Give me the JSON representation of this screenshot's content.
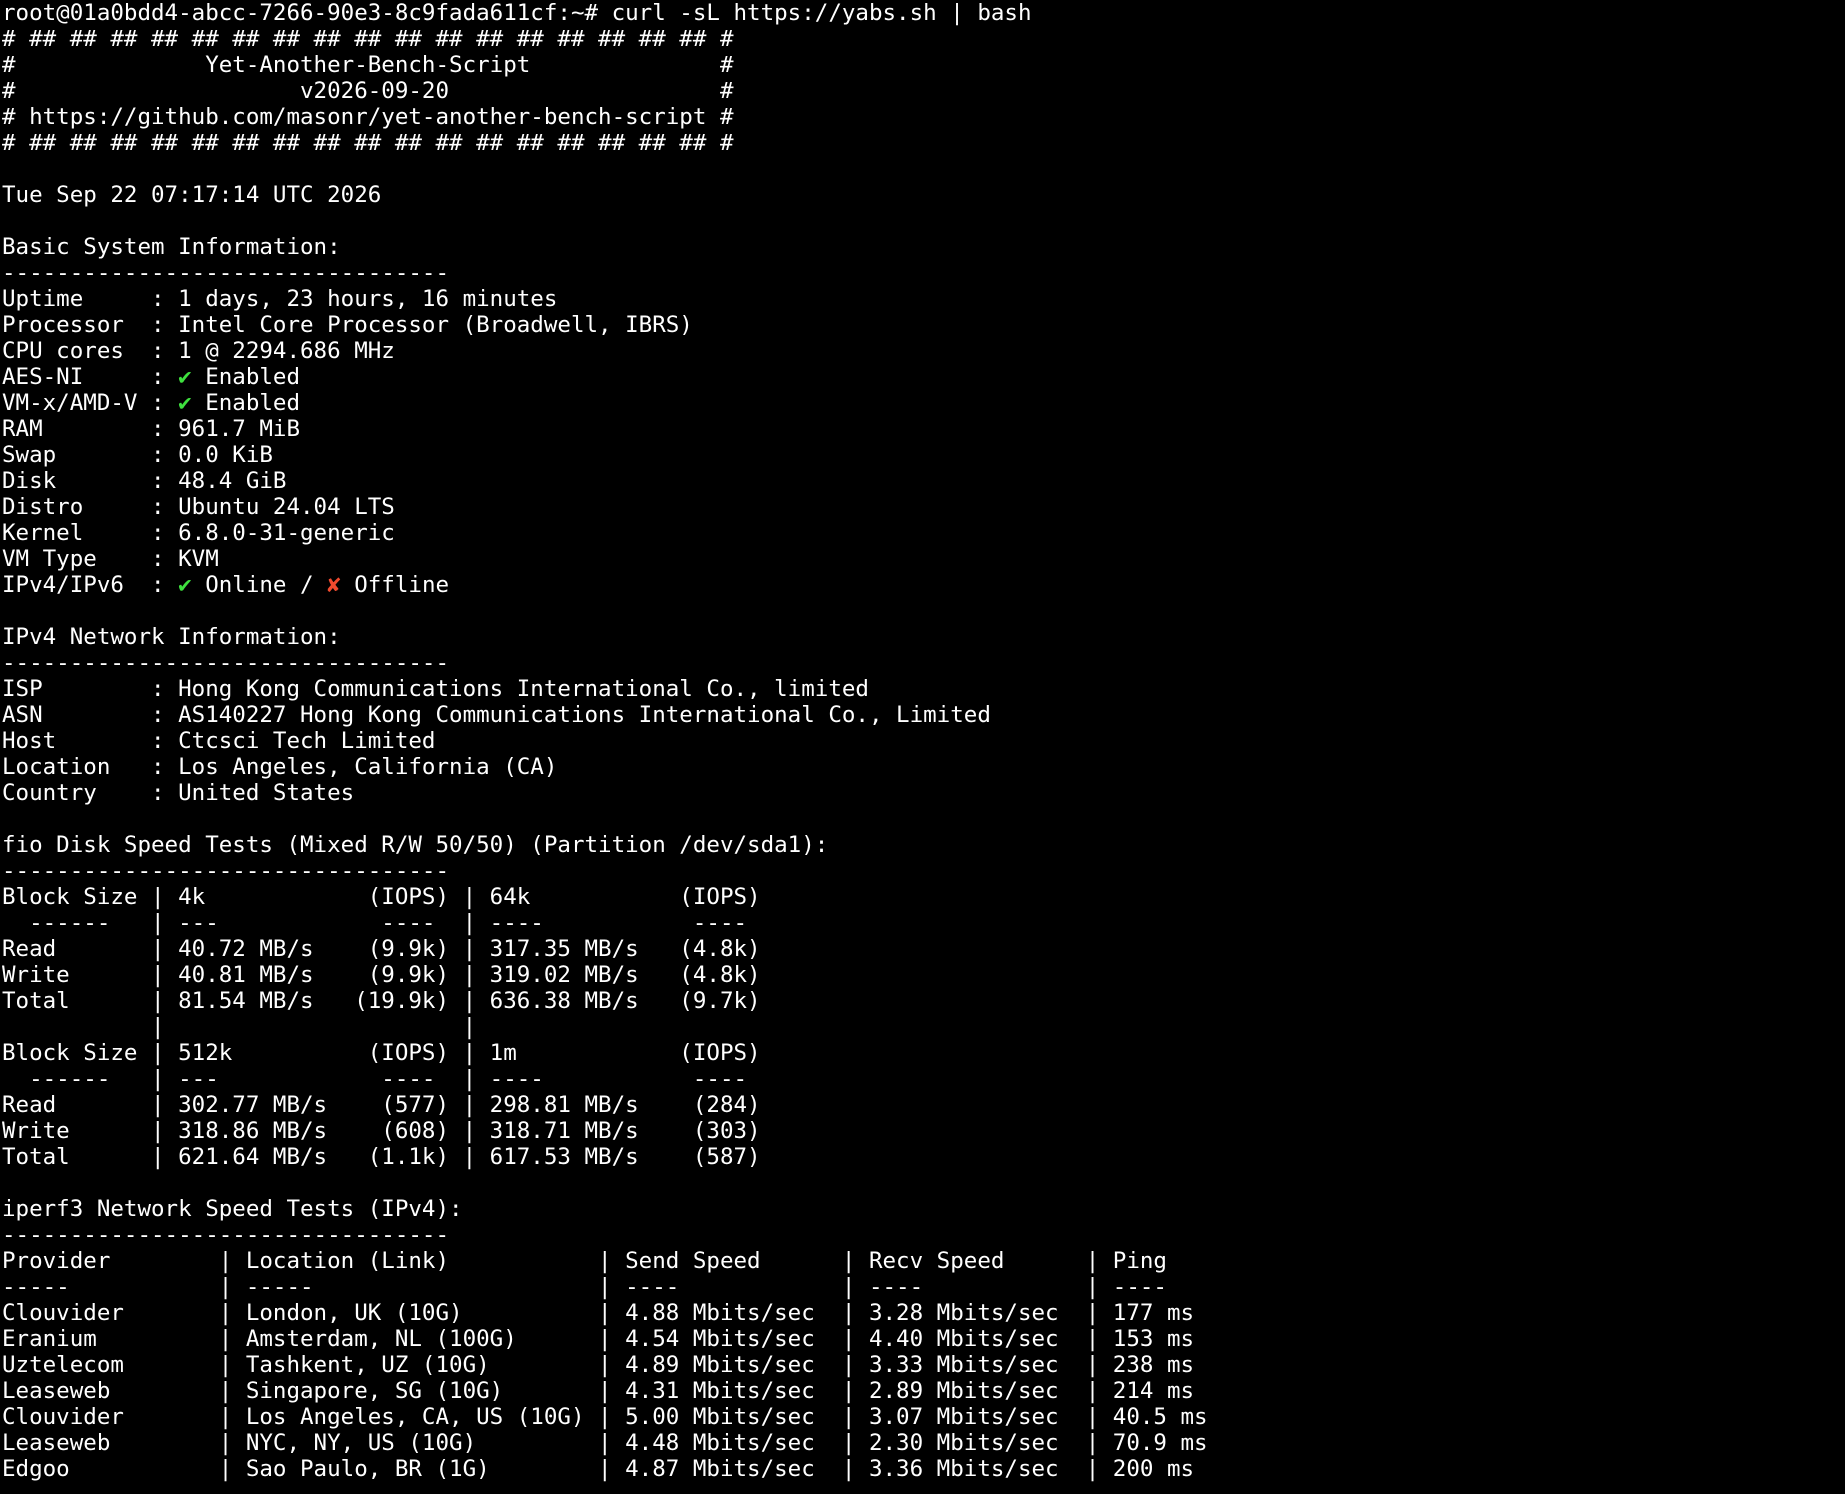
{
  "colors": {
    "background": "#000000",
    "foreground": "#ffffff",
    "check_green": "#3ee03e",
    "cross_red": "#f04a2e"
  },
  "lines": [
    [
      {
        "t": "root@01a0bdd4-abcc-7266-90e3-8c9fada611cf:~# curl -sL https://yabs.sh | bash"
      }
    ],
    [
      {
        "t": "# ## ## ## ## ## ## ## ## ## ## ## ## ## ## ## ## ## #"
      }
    ],
    [
      {
        "t": "#              Yet-Another-Bench-Script              #"
      }
    ],
    [
      {
        "t": "#                     v2026-09-20                    #"
      }
    ],
    [
      {
        "t": "# https://github.com/masonr/yet-another-bench-script #"
      }
    ],
    [
      {
        "t": "# ## ## ## ## ## ## ## ## ## ## ## ## ## ## ## ## ## #"
      }
    ],
    [
      {
        "t": ""
      }
    ],
    [
      {
        "t": "Tue Sep 22 07:17:14 UTC 2026"
      }
    ],
    [
      {
        "t": ""
      }
    ],
    [
      {
        "t": "Basic System Information:"
      }
    ],
    [
      {
        "t": "---------------------------------"
      }
    ],
    [
      {
        "t": "Uptime     : 1 days, 23 hours, 16 minutes"
      }
    ],
    [
      {
        "t": "Processor  : Intel Core Processor (Broadwell, IBRS)"
      }
    ],
    [
      {
        "t": "CPU cores  : 1 @ 2294.686 MHz"
      }
    ],
    [
      {
        "t": "AES-NI     : "
      },
      {
        "t": "✔",
        "c": "ok",
        "icon": "check-icon"
      },
      {
        "t": " Enabled"
      }
    ],
    [
      {
        "t": "VM-x/AMD-V : "
      },
      {
        "t": "✔",
        "c": "ok",
        "icon": "check-icon"
      },
      {
        "t": " Enabled"
      }
    ],
    [
      {
        "t": "RAM        : 961.7 MiB"
      }
    ],
    [
      {
        "t": "Swap       : 0.0 KiB"
      }
    ],
    [
      {
        "t": "Disk       : 48.4 GiB"
      }
    ],
    [
      {
        "t": "Distro     : Ubuntu 24.04 LTS"
      }
    ],
    [
      {
        "t": "Kernel     : 6.8.0-31-generic"
      }
    ],
    [
      {
        "t": "VM Type    : KVM"
      }
    ],
    [
      {
        "t": "IPv4/IPv6  : "
      },
      {
        "t": "✔",
        "c": "ok",
        "icon": "check-icon"
      },
      {
        "t": " Online / "
      },
      {
        "t": "✘",
        "c": "fail",
        "icon": "cross-icon"
      },
      {
        "t": " Offline"
      }
    ],
    [
      {
        "t": ""
      }
    ],
    [
      {
        "t": "IPv4 Network Information:"
      }
    ],
    [
      {
        "t": "---------------------------------"
      }
    ],
    [
      {
        "t": "ISP        : Hong Kong Communications International Co., limited"
      }
    ],
    [
      {
        "t": "ASN        : AS140227 Hong Kong Communications International Co., Limited"
      }
    ],
    [
      {
        "t": "Host       : Ctcsci Tech Limited"
      }
    ],
    [
      {
        "t": "Location   : Los Angeles, California (CA)"
      }
    ],
    [
      {
        "t": "Country    : United States"
      }
    ],
    [
      {
        "t": ""
      }
    ],
    [
      {
        "t": "fio Disk Speed Tests (Mixed R/W 50/50) (Partition /dev/sda1):"
      }
    ],
    [
      {
        "t": "---------------------------------"
      }
    ],
    [
      {
        "t": "Block Size | 4k            (IOPS) | 64k           (IOPS)"
      }
    ],
    [
      {
        "t": "  ------   | ---            ----  | ----           ----"
      }
    ],
    [
      {
        "t": "Read       | 40.72 MB/s    (9.9k) | 317.35 MB/s   (4.8k)"
      }
    ],
    [
      {
        "t": "Write      | 40.81 MB/s    (9.9k) | 319.02 MB/s   (4.8k)"
      }
    ],
    [
      {
        "t": "Total      | 81.54 MB/s   (19.9k) | 636.38 MB/s   (9.7k)"
      }
    ],
    [
      {
        "t": "           |                      |"
      }
    ],
    [
      {
        "t": "Block Size | 512k          (IOPS) | 1m            (IOPS)"
      }
    ],
    [
      {
        "t": "  ------   | ---            ----  | ----           ----"
      }
    ],
    [
      {
        "t": "Read       | 302.77 MB/s    (577) | 298.81 MB/s    (284)"
      }
    ],
    [
      {
        "t": "Write      | 318.86 MB/s    (608) | 318.71 MB/s    (303)"
      }
    ],
    [
      {
        "t": "Total      | 621.64 MB/s   (1.1k) | 617.53 MB/s    (587)"
      }
    ],
    [
      {
        "t": ""
      }
    ],
    [
      {
        "t": "iperf3 Network Speed Tests (IPv4):"
      }
    ],
    [
      {
        "t": "---------------------------------"
      }
    ],
    [
      {
        "t": "Provider        | Location (Link)           | Send Speed      | Recv Speed      | Ping"
      }
    ],
    [
      {
        "t": "-----           | -----                     | ----            | ----            | ----"
      }
    ],
    [
      {
        "t": "Clouvider       | London, UK (10G)          | 4.88 Mbits/sec  | 3.28 Mbits/sec  | 177 ms"
      }
    ],
    [
      {
        "t": "Eranium         | Amsterdam, NL (100G)      | 4.54 Mbits/sec  | 4.40 Mbits/sec  | 153 ms"
      }
    ],
    [
      {
        "t": "Uztelecom       | Tashkent, UZ (10G)        | 4.89 Mbits/sec  | 3.33 Mbits/sec  | 238 ms"
      }
    ],
    [
      {
        "t": "Leaseweb        | Singapore, SG (10G)       | 4.31 Mbits/sec  | 2.89 Mbits/sec  | 214 ms"
      }
    ],
    [
      {
        "t": "Clouvider       | Los Angeles, CA, US (10G) | 5.00 Mbits/sec  | 3.07 Mbits/sec  | 40.5 ms"
      }
    ],
    [
      {
        "t": "Leaseweb        | NYC, NY, US (10G)         | 4.48 Mbits/sec  | 2.30 Mbits/sec  | 70.9 ms"
      }
    ],
    [
      {
        "t": "Edgoo           | Sao Paulo, BR (1G)        | 4.87 Mbits/sec  | 3.36 Mbits/sec  | 200 ms"
      }
    ]
  ]
}
